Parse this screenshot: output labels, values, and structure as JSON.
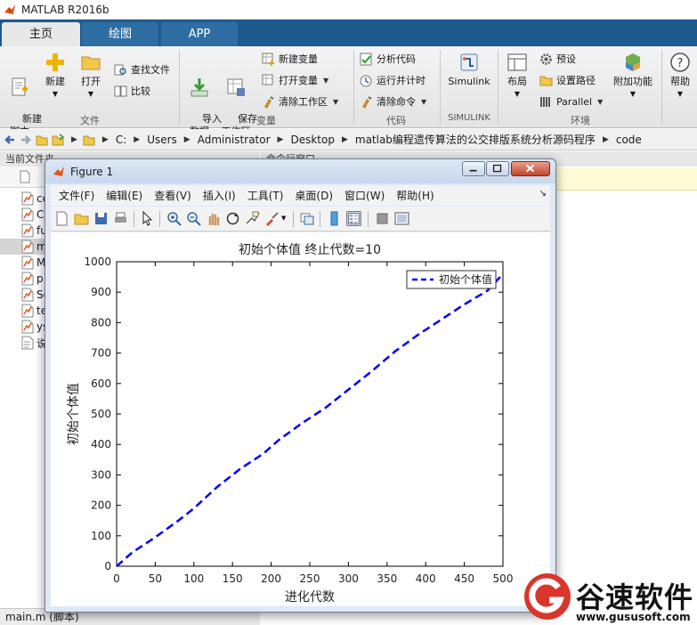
{
  "window": {
    "title": "MATLAB R2016b"
  },
  "tabs": [
    {
      "label": "主页"
    },
    {
      "label": "绘图"
    },
    {
      "label": "APP"
    }
  ],
  "ribbon": {
    "file": {
      "new_script": "新建\n脚本",
      "new": "新建",
      "open": "打开",
      "find_files": "查找文件",
      "compare": "比较",
      "section": "文件"
    },
    "variable": {
      "import_data": "导入\n数据",
      "save_workspace": "保存\n工作区",
      "new_variable": "新建变量",
      "open_variable": "打开变量",
      "clear_workspace": "清除工作区",
      "section": "变量"
    },
    "code": {
      "analyze_code": "分析代码",
      "run_and_time": "运行并计时",
      "clear_commands": "清除命令",
      "section": "代码"
    },
    "simulink": {
      "simulink": "Simulink",
      "section": "SIMULINK"
    },
    "environment": {
      "layout": "布局",
      "preferences": "预设",
      "set_path": "设置路径",
      "parallel": "Parallel",
      "add_ons": "附加功能",
      "section": "环境"
    },
    "resources": {
      "help": "帮助"
    }
  },
  "address_bar": {
    "path": [
      "C:",
      "Users",
      "Administrator",
      "Desktop",
      "matlab编程遗传算法的公交排版系统分析源码程序",
      "code"
    ]
  },
  "current_folder": {
    "title": "当前文件夹",
    "column_header": "名",
    "files": [
      {
        "name": "ce"
      },
      {
        "name": "C"
      },
      {
        "name": "fu"
      },
      {
        "name": "m"
      },
      {
        "name": "M"
      },
      {
        "name": "p"
      },
      {
        "name": "Se"
      },
      {
        "name": "te"
      },
      {
        "name": "ys"
      },
      {
        "name": "说"
      }
    ],
    "status": "main.m (脚本)"
  },
  "command_window": {
    "title": "命令行窗口"
  },
  "figure": {
    "title": "Figure 1",
    "menus": [
      "文件(F)",
      "编辑(E)",
      "查看(V)",
      "插入(I)",
      "工具(T)",
      "桌面(D)",
      "窗口(W)",
      "帮助(H)"
    ],
    "toolbar_icons": [
      "new-figure-icon",
      "open-file-icon",
      "save-icon",
      "print-icon",
      "pointer-icon",
      "zoom-in-icon",
      "zoom-out-icon",
      "pan-icon",
      "rotate-3d-icon",
      "data-cursor-icon",
      "brush-icon",
      "link-plot-icon",
      "colorbar-icon",
      "legend-icon",
      "hide-plot-tools-icon",
      "show-plot-tools-icon"
    ]
  },
  "chart_data": {
    "type": "line",
    "title": "初始个体值  终止代数=10",
    "xlabel": "进化代数",
    "ylabel": "初始个体值",
    "xlim": [
      0,
      500
    ],
    "ylim": [
      0,
      1000
    ],
    "xticks": [
      0,
      50,
      100,
      150,
      200,
      250,
      300,
      350,
      400,
      450,
      500
    ],
    "yticks": [
      0,
      100,
      200,
      300,
      400,
      500,
      600,
      700,
      800,
      900,
      1000
    ],
    "grid": false,
    "legend_position": "top-right",
    "series": [
      {
        "name": "初始个体值",
        "color": "#0000ff",
        "style": "dashed",
        "x": [
          0,
          20,
          50,
          80,
          100,
          130,
          160,
          190,
          210,
          240,
          270,
          300,
          330,
          360,
          390,
          420,
          450,
          480,
          500
        ],
        "y": [
          0,
          45,
          95,
          150,
          190,
          260,
          320,
          370,
          415,
          470,
          520,
          580,
          640,
          705,
          760,
          810,
          860,
          905,
          960
        ]
      }
    ]
  },
  "watermark": {
    "text": "谷速软件",
    "url": "www.gususoft.com"
  }
}
